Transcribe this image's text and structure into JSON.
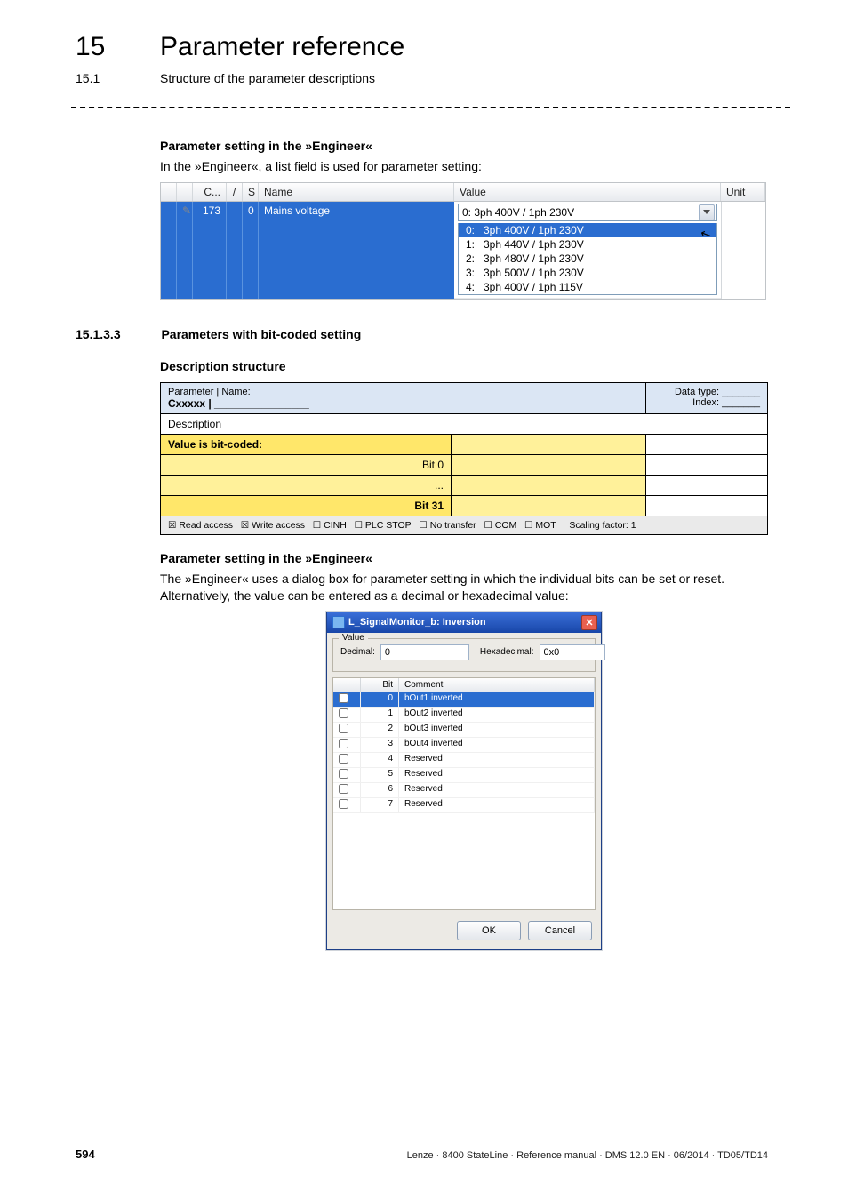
{
  "chapter": {
    "num": "15",
    "title": "Parameter reference"
  },
  "section": {
    "num": "15.1",
    "title": "Structure of the parameter descriptions"
  },
  "engineer1": {
    "heading": "Parameter setting in the »Engineer«",
    "intro": "In the »Engineer«, a list field is used for parameter setting:",
    "columns": {
      "c": "C...",
      "slash": "/",
      "s": "S",
      "name": "Name",
      "value": "Value",
      "unit": "Unit"
    },
    "row": {
      "c": "173",
      "s": "0",
      "name": "Mains voltage",
      "pencil": "✎"
    },
    "selected": "0:   3ph 400V / 1ph 230V",
    "options": [
      {
        "idx": "0:",
        "label": "3ph 400V / 1ph 230V"
      },
      {
        "idx": "1:",
        "label": "3ph 440V / 1ph 230V"
      },
      {
        "idx": "2:",
        "label": "3ph 480V / 1ph 230V"
      },
      {
        "idx": "3:",
        "label": "3ph 500V / 1ph 230V"
      },
      {
        "idx": "4:",
        "label": "3ph 400V / 1ph 115V"
      }
    ],
    "cursor_glyph": "↖"
  },
  "subsection": {
    "num": "15.1.3.3",
    "title": "Parameters with bit-coded setting",
    "desc_heading": "Description structure"
  },
  "dstable": {
    "top": {
      "left_label": "Parameter | Name:",
      "left_code": "Cxxxxx | ________________",
      "right1": "Data type: _______",
      "right2": "Index: _______"
    },
    "desc_row": "Description",
    "bitcoded": "Value is bit-coded:",
    "bit0": "Bit 0",
    "dots": "...",
    "bit31": "Bit 31",
    "foot": {
      "read": "☒ Read access",
      "write": "☒ Write access",
      "cinh": "☐ CINH",
      "plc": "☐ PLC STOP",
      "notrans": "☐ No transfer",
      "com": "☐ COM",
      "mot": "☐ MOT",
      "scale": "Scaling factor: 1"
    }
  },
  "engineer2": {
    "heading": "Parameter setting in the »Engineer«",
    "intro": "The »Engineer« uses a dialog box for parameter setting in which the individual bits can be set or reset. Alternatively, the value can be entered as a decimal or hexadecimal value:"
  },
  "bitdlg": {
    "title": "L_SignalMonitor_b: Inversion",
    "close": "✕",
    "group_label": "Value",
    "decimal_label": "Decimal:",
    "decimal_value": "0",
    "hex_label": "Hexadecimal:",
    "hex_value": "0x0",
    "grid_headers": {
      "bit": "Bit",
      "comment": "Comment"
    },
    "rows": [
      {
        "bit": "0",
        "comment": "bOut1 inverted",
        "selected": true
      },
      {
        "bit": "1",
        "comment": "bOut2 inverted"
      },
      {
        "bit": "2",
        "comment": "bOut3 inverted"
      },
      {
        "bit": "3",
        "comment": "bOut4 inverted"
      },
      {
        "bit": "4",
        "comment": "Reserved"
      },
      {
        "bit": "5",
        "comment": "Reserved"
      },
      {
        "bit": "6",
        "comment": "Reserved"
      },
      {
        "bit": "7",
        "comment": "Reserved"
      }
    ],
    "ok": "OK",
    "cancel": "Cancel"
  },
  "footer": {
    "page": "594",
    "text": "Lenze · 8400 StateLine · Reference manual · DMS 12.0 EN · 06/2014 · TD05/TD14"
  }
}
